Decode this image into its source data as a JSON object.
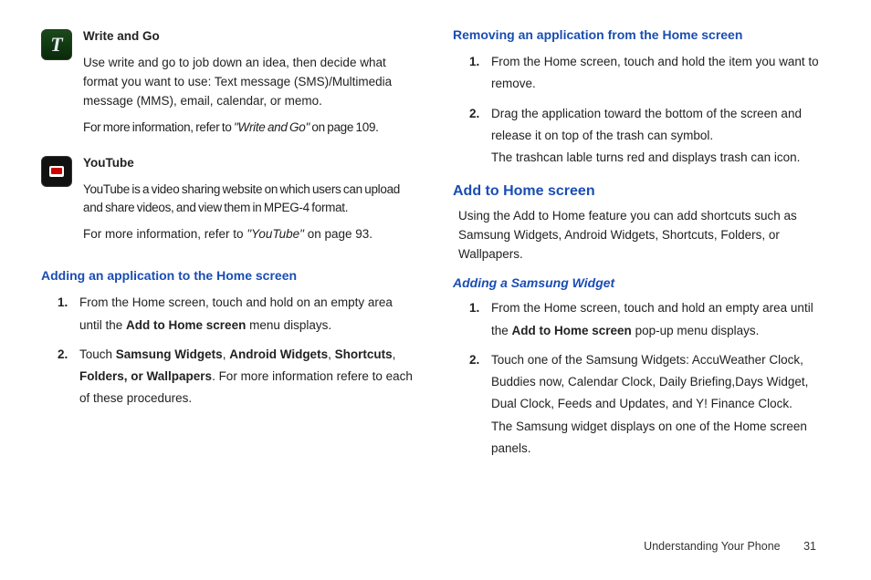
{
  "left": {
    "apps": [
      {
        "icon_glyph": "T",
        "title": "Write and Go",
        "desc": "Use write and go to job down an idea, then decide what format you want to use: Text message (SMS)/Multimedia message (MMS), email, calendar, or memo.",
        "ref_pre": "For more information, refer to ",
        "ref_title": "\"Write and Go\"",
        "ref_post": " on page 109."
      },
      {
        "icon_glyph": "",
        "title": "YouTube",
        "desc": "YouTube is a video sharing website on which users can upload and share videos, and view them in MPEG-4 format.",
        "ref_pre": "For more information, refer to ",
        "ref_title": "\"YouTube\"",
        "ref_post": "  on page 93."
      }
    ],
    "section1": {
      "heading": "Adding an application to the Home screen",
      "step1_a": "From the Home screen, touch and hold on an empty area until the ",
      "step1_b": "Add to Home screen",
      "step1_c": " menu displays.",
      "step2_a": "Touch ",
      "step2_b": "Samsung Widgets",
      "step2_c": ", ",
      "step2_d": "Android Widgets",
      "step2_e": ", ",
      "step2_f": "Shortcuts",
      "step2_g": ", ",
      "step2_h": "Folders",
      "step2_i": ", or ",
      "step2_j": "Wallpapers",
      "step2_k": ". For more information refere to each of these procedures."
    }
  },
  "right": {
    "section1": {
      "heading": "Removing an application from the Home screen",
      "step1": "From the Home screen, touch and hold the item you want to remove.",
      "step2": "Drag the application toward the bottom of the screen and release it on top of the trash can symbol.",
      "step2b": "The trashcan lable turns red and displays trash can icon."
    },
    "section2": {
      "heading": "Add to Home screen",
      "intro": "Using the Add to Home feature you can add shortcuts such as Samsung Widgets, Android Widgets, Shortcuts, Folders, or Wallpapers."
    },
    "section3": {
      "heading": "Adding a Samsung Widget",
      "step1_a": "From the Home screen, touch and hold an empty area until the ",
      "step1_b": "Add to Home screen",
      "step1_c": " pop-up menu displays.",
      "step2": "Touch one of the Samsung Widgets: AccuWeather Clock, Buddies now, Calendar Clock, Daily Briefing,Days Widget, Dual Clock, Feeds and Updates, and Y! Finance Clock.",
      "step2b": "The Samsung widget displays on one of the Home screen panels."
    }
  },
  "footer": {
    "section": "Understanding Your Phone",
    "page": "31"
  }
}
